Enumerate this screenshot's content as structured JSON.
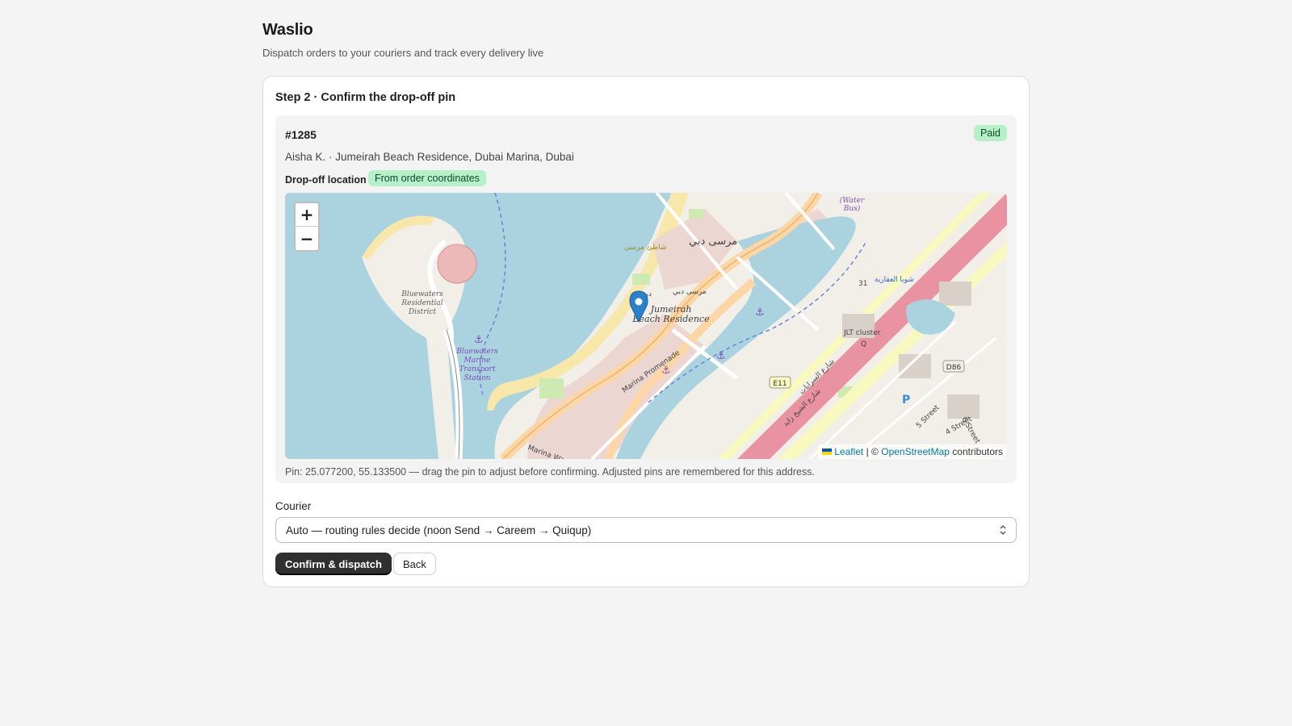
{
  "app": {
    "title": "Waslio",
    "subtitle": "Dispatch orders to your couriers and track every delivery live"
  },
  "step": {
    "title": "Step 2 · Confirm the drop-off pin"
  },
  "order": {
    "id": "#1285",
    "status": "Paid",
    "address": "Aisha K. · Jumeirah Beach Residence, Dubai Marina, Dubai",
    "dropoff_label": "Drop-off location",
    "dropoff_source": "From order coordinates"
  },
  "map": {
    "zoom_in": "+",
    "zoom_out": "−",
    "attribution": {
      "leaflet": "Leaflet",
      "separator": "| ©",
      "osm": "OpenStreetMap",
      "contributors": "contributors"
    },
    "labels": {
      "bluewaters_1": "Bluewaters",
      "bluewaters_2": "Residential",
      "bluewaters_3": "District",
      "transport_1": "Bluewaters",
      "transport_2": "Marine",
      "transport_3": "Transport",
      "transport_4": "Station",
      "jbr_1": "Jumeirah",
      "jbr_2": "Beach Residence",
      "jlt": "JLT cluster",
      "q_label": "Q",
      "e11": "E11",
      "d86": "D86",
      "water_bus_1": "(Water",
      "water_bus_2": "Bus)",
      "marina_promenade": "Marina Promenade",
      "marina_walk": "Marina Wa",
      "parking": "P",
      "street_5": "5 Street",
      "street_4": "4 Street",
      "street_6": "6 Street",
      "marsa_dubai": "مرسى دبي",
      "marsa_dubai_2": "مرسى دبي",
      "marsa_beach": "شاطئ مرسى",
      "dubai_ar": "دبي",
      "sobha": "شوبا العقارية",
      "sheikh_zayed": "شارع الشيخ زايد",
      "sarayat": "شارع السرايات",
      "num_31": "31"
    },
    "accent": "#2a81cb"
  },
  "pin_hint": "Pin: 25.077200, 55.133500 — drag the pin to adjust before confirming. Adjusted pins are remembered for this address.",
  "courier": {
    "label": "Courier",
    "selected": "Auto — routing rules decide (noon Send → Careem → Quiqup)"
  },
  "actions": {
    "confirm": "Confirm & dispatch",
    "back": "Back"
  }
}
